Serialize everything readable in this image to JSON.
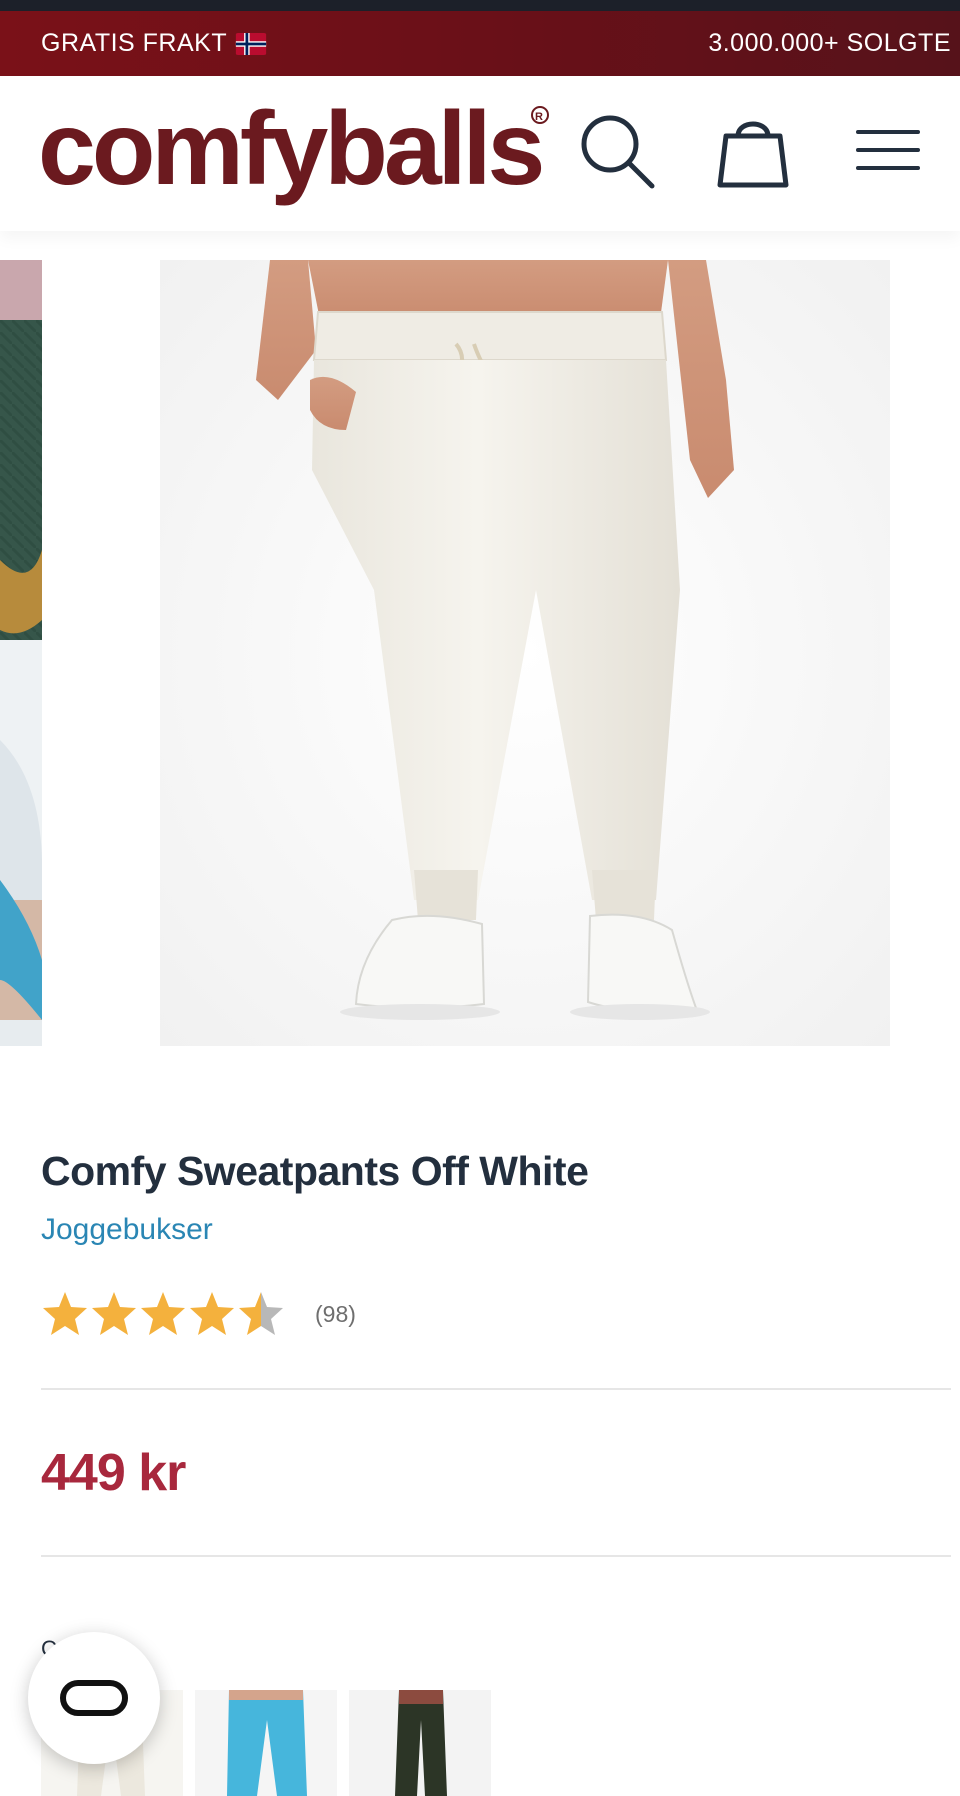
{
  "announcement": {
    "left_text": "GRATIS FRAKT",
    "right_text": "3.000.000+ SOLGTE",
    "background": "#6a1018"
  },
  "header": {
    "logo_text": "comfyballs",
    "logo_mark": "®",
    "logo_color": "#6b1a1f",
    "icons": [
      "search-icon",
      "bag-icon",
      "menu-icon"
    ]
  },
  "product": {
    "title": "Comfy Sweatpants Off White",
    "category": "Joggebukser",
    "rating": 4.5,
    "rating_max": 5,
    "review_count": "(98)",
    "price": "449 kr",
    "price_color": "#a8283d",
    "color_label": "Cre...e",
    "swatches": [
      "off-white",
      "light-blue",
      "dark-green"
    ]
  },
  "chat": {
    "icon": "chat-logo-icon"
  }
}
